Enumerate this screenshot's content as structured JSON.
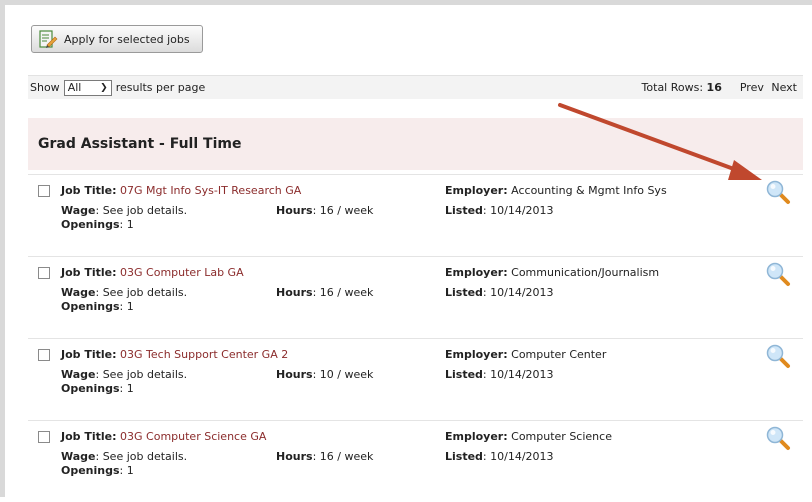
{
  "apply_button": {
    "label": "Apply for selected jobs"
  },
  "toolbar": {
    "show_label": "Show",
    "per_page_value": "All",
    "per_page_suffix": "results per page",
    "total_label": "Total Rows:",
    "total_value": "16",
    "prev_label": "Prev",
    "next_label": "Next"
  },
  "group": {
    "title": "Grad Assistant - Full Time"
  },
  "labels": {
    "job_title": "Job Title:",
    "employer": "Employer:",
    "wage": "Wage",
    "hours": "Hours",
    "listed": "Listed",
    "openings": "Openings"
  },
  "jobs": [
    {
      "title": "07G Mgt Info Sys-IT Research GA",
      "employer": "Accounting & Mgmt Info Sys",
      "wage": "See job details.",
      "hours": "16 / week",
      "listed": "10/14/2013",
      "openings": "1"
    },
    {
      "title": "03G Computer Lab GA",
      "employer": "Communication/Journalism",
      "wage": "See job details.",
      "hours": "16 / week",
      "listed": "10/14/2013",
      "openings": "1"
    },
    {
      "title": "03G Tech Support Center GA 2",
      "employer": "Computer Center",
      "wage": "See job details.",
      "hours": "10 / week",
      "listed": "10/14/2013",
      "openings": "1"
    },
    {
      "title": "03G Computer Science GA",
      "employer": "Computer Science",
      "wage": "See job details.",
      "hours": "16 / week",
      "listed": "10/14/2013",
      "openings": "1"
    }
  ],
  "colors": {
    "link": "#8b2c2c",
    "group_bg": "#f7ecec",
    "arrow": "#c0482e",
    "magnifier": "#8fc0e8"
  },
  "icons": {
    "apply": "document-pencil-icon",
    "detail": "magnifier-icon",
    "dropdown": "chevron-down-icon"
  }
}
